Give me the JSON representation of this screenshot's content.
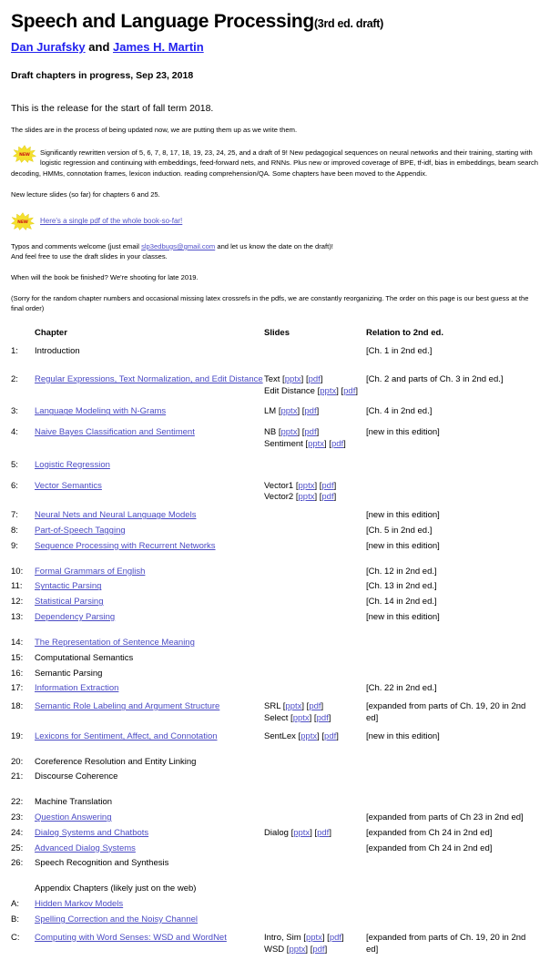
{
  "header": {
    "title_main": "Speech and Language Processing",
    "title_sub": "(3rd ed. draft)",
    "author1": "Dan Jurafsky",
    "author_conj": " and ",
    "author2": "James H. Martin",
    "draft_line": "Draft chapters in progress, Sep 23, 2018"
  },
  "intro": {
    "release_line": "This is the release for the start of fall term 2018.",
    "slides_updating": "The slides are in the process of being updated now, we are putting them up as we write them.",
    "new_badge_label": "NEW",
    "new_paragraph": "Significantly rewritten version of 5, 6, 7, 8, 17, 18, 19, 23, 24, 25, and a draft of 9! New pedagogical sequences on neural networks and their training, starting with logistic regression and continuing with embeddings, feed-forward nets, and RNNs. Plus new or improved coverage of BPE, tf-idf, bias in embeddings, beam search decoding, HMMs, connotation frames, lexicon induction. reading comprehension/QA. Some chapters have been moved to the Appendix.",
    "new_lecture_slides": "New lecture slides (so far) for chapters 6 and 25.",
    "single_pdf_link": "Here's a single pdf of the whole book-so-far!",
    "typos_prefix": "Typos and comments welcome (just email ",
    "typos_email": "slp3edbugs@gmail.com",
    "typos_suffix": " and let us know the date on the draft)!",
    "typos_line2": "And feel free to use the draft slides in your classes.",
    "finish_line": "When will the book be finished? We're shooting for late 2019.",
    "sorry_line": "(Sorry for the random chapter numbers and occasional missing latex crossrefs in the pdfs, we are constantly reorganizing. The order on this page is our best guess at the final order)"
  },
  "table": {
    "headers": {
      "chapter": "Chapter",
      "slides": "Slides",
      "relation": "Relation to 2nd ed."
    },
    "appendix_heading": "Appendix Chapters (likely just on the web)",
    "rows": [
      {
        "num": "1:",
        "chapter": "Introduction",
        "chapter_link": false,
        "slides": [],
        "relation": "[Ch. 1 in 2nd ed.]",
        "spacer_after": true,
        "tall": false
      },
      {
        "num": "2:",
        "chapter": "Regular Expressions, Text Normalization, and Edit Distance",
        "chapter_link": true,
        "slides": [
          {
            "label": "Text",
            "pptx": "pptx",
            "pdf": "pdf"
          },
          {
            "label": "Edit Distance",
            "pptx": "pptx",
            "pdf": "pdf"
          }
        ],
        "relation": "[Ch. 2 and parts of Ch. 3 in 2nd ed.]",
        "spacer_after": false,
        "tall": true
      },
      {
        "num": "3:",
        "chapter": "Language Modeling with N-Grams",
        "chapter_link": true,
        "slides": [
          {
            "label": "LM",
            "pptx": "pptx",
            "pdf": "pdf"
          }
        ],
        "relation": "[Ch. 4 in 2nd ed.]",
        "spacer_after": false,
        "tall": true
      },
      {
        "num": "4:",
        "chapter": "Naive Bayes Classification and Sentiment",
        "chapter_link": true,
        "slides": [
          {
            "label": "NB",
            "pptx": "pptx",
            "pdf": "pdf"
          },
          {
            "label": "Sentiment",
            "pptx": "pptx",
            "pdf": "pdf"
          }
        ],
        "relation": "[new in this edition]",
        "spacer_after": false,
        "tall": true
      },
      {
        "num": "5:",
        "chapter": "Logistic Regression",
        "chapter_link": true,
        "slides": [],
        "relation": "",
        "spacer_after": false,
        "tall": true
      },
      {
        "num": "6:",
        "chapter": "Vector Semantics",
        "chapter_link": true,
        "slides": [
          {
            "label": "Vector1",
            "pptx": "pptx",
            "pdf": "pdf"
          },
          {
            "label": "Vector2",
            "pptx": "pptx",
            "pdf": "pdf"
          }
        ],
        "relation": "",
        "spacer_after": false,
        "tall": true
      },
      {
        "num": "7:",
        "chapter": "Neural Nets and Neural Language Models",
        "chapter_link": true,
        "slides": [],
        "relation": "[new in this edition]",
        "spacer_after": false,
        "tall": false
      },
      {
        "num": "8:",
        "chapter": "Part-of-Speech Tagging",
        "chapter_link": true,
        "slides": [],
        "relation": "[Ch. 5 in 2nd ed.]",
        "spacer_after": false,
        "tall": false
      },
      {
        "num": "9:",
        "chapter": "Sequence Processing with Recurrent Networks",
        "chapter_link": true,
        "slides": [],
        "relation": "[new in this edition]",
        "spacer_after": true,
        "tall": false
      },
      {
        "num": "10:",
        "chapter": "Formal Grammars of English",
        "chapter_link": true,
        "slides": [],
        "relation": "[Ch. 12 in 2nd ed.]",
        "spacer_after": false,
        "tall": false
      },
      {
        "num": "11:",
        "chapter": "Syntactic Parsing",
        "chapter_link": true,
        "slides": [],
        "relation": "[Ch. 13 in 2nd ed.]",
        "spacer_after": false,
        "tall": false
      },
      {
        "num": "12:",
        "chapter": "Statistical Parsing",
        "chapter_link": true,
        "slides": [],
        "relation": "[Ch. 14 in 2nd ed.]",
        "spacer_after": false,
        "tall": false
      },
      {
        "num": "13:",
        "chapter": "Dependency Parsing",
        "chapter_link": true,
        "slides": [],
        "relation": "[new in this edition]",
        "spacer_after": true,
        "tall": false
      },
      {
        "num": "14:",
        "chapter": "The Representation of Sentence Meaning",
        "chapter_link": true,
        "slides": [],
        "relation": "",
        "spacer_after": false,
        "tall": false
      },
      {
        "num": "15:",
        "chapter": "Computational Semantics",
        "chapter_link": false,
        "slides": [],
        "relation": "",
        "spacer_after": false,
        "tall": false
      },
      {
        "num": "16:",
        "chapter": "Semantic Parsing",
        "chapter_link": false,
        "slides": [],
        "relation": "",
        "spacer_after": false,
        "tall": false
      },
      {
        "num": "17:",
        "chapter": "Information Extraction",
        "chapter_link": true,
        "slides": [],
        "relation": "[Ch. 22 in 2nd ed.]",
        "spacer_after": false,
        "tall": false
      },
      {
        "num": "18:",
        "chapter": "Semantic Role Labeling and Argument Structure",
        "chapter_link": true,
        "slides": [
          {
            "label": "SRL",
            "pptx": "pptx",
            "pdf": "pdf"
          },
          {
            "label": "Select",
            "pptx": "pptx",
            "pdf": "pdf"
          }
        ],
        "relation": "[expanded from parts of Ch. 19, 20 in 2nd ed]",
        "spacer_after": false,
        "tall": true
      },
      {
        "num": "19:",
        "chapter": "Lexicons for Sentiment, Affect, and Connotation",
        "chapter_link": true,
        "slides": [
          {
            "label": "SentLex",
            "pptx": "pptx",
            "pdf": "pdf"
          }
        ],
        "relation": "[new in this edition]",
        "spacer_after": true,
        "tall": false
      },
      {
        "num": "20:",
        "chapter": "Coreference Resolution and Entity Linking",
        "chapter_link": false,
        "slides": [],
        "relation": "",
        "spacer_after": false,
        "tall": false
      },
      {
        "num": "21:",
        "chapter": "Discourse Coherence",
        "chapter_link": false,
        "slides": [],
        "relation": "",
        "spacer_after": true,
        "tall": false
      },
      {
        "num": "22:",
        "chapter": "Machine Translation",
        "chapter_link": false,
        "slides": [],
        "relation": "",
        "spacer_after": false,
        "tall": false
      },
      {
        "num": "23:",
        "chapter": "Question Answering",
        "chapter_link": true,
        "slides": [],
        "relation": "[expanded from parts of Ch 23 in 2nd ed]",
        "spacer_after": false,
        "tall": false
      },
      {
        "num": "24:",
        "chapter": "Dialog Systems and Chatbots",
        "chapter_link": true,
        "slides": [
          {
            "label": "Dialog",
            "pptx": "pptx",
            "pdf": "pdf"
          }
        ],
        "relation": "[expanded from Ch 24 in 2nd ed]",
        "spacer_after": false,
        "tall": false
      },
      {
        "num": "25:",
        "chapter": "Advanced Dialog Systems",
        "chapter_link": true,
        "slides": [],
        "relation": "[expanded from Ch 24 in 2nd ed]",
        "spacer_after": false,
        "tall": false
      },
      {
        "num": "26:",
        "chapter": "Speech Recognition and Synthesis",
        "chapter_link": false,
        "slides": [],
        "relation": "",
        "spacer_after": true,
        "tall": false
      }
    ],
    "appendix_rows": [
      {
        "num": "A:",
        "chapter": "Hidden Markov Models",
        "chapter_link": true,
        "slides": [],
        "relation": "",
        "spacer_after": false,
        "tall": false
      },
      {
        "num": "B:",
        "chapter": "Spelling Correction and the Noisy Channel",
        "chapter_link": true,
        "slides": [],
        "relation": "",
        "spacer_after": false,
        "tall": false
      },
      {
        "num": "C:",
        "chapter": "Computing with Word Senses: WSD and WordNet",
        "chapter_link": true,
        "slides": [
          {
            "label": "Intro, Sim",
            "pptx": "pptx",
            "pdf": "pdf"
          },
          {
            "label": "WSD",
            "pptx": "pptx",
            "pdf": "pdf"
          }
        ],
        "relation": "[expanded from parts of Ch. 19, 20 in 2nd ed]",
        "spacer_after": false,
        "tall": true
      }
    ]
  },
  "colors": {
    "link_blue": "#5050c8",
    "author_blue": "#2222ee",
    "text_black": "#000000",
    "burst_yellow": "#f7e33a",
    "burst_red": "#d02020"
  }
}
